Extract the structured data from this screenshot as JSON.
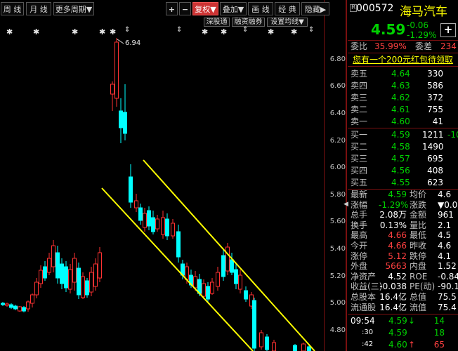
{
  "toolbar": {
    "left": [
      {
        "label": "周 线"
      },
      {
        "label": "月 线"
      },
      {
        "label": "更多周期▼"
      }
    ],
    "right": [
      {
        "label": "+"
      },
      {
        "label": "−"
      },
      {
        "label": "复权▼"
      },
      {
        "label": "叠加▼"
      },
      {
        "label": "画 线"
      },
      {
        "label": "经 典"
      },
      {
        "label": "隐藏▶"
      }
    ],
    "sub": [
      {
        "label": "深股通"
      },
      {
        "label": "融资融券"
      },
      {
        "label": "设置均线▼"
      }
    ]
  },
  "chart": {
    "max_label": "6.94",
    "y_labels": [
      "6.80",
      "6.60",
      "6.40",
      "6.20",
      "6.00",
      "5.80",
      "5.60",
      "5.40",
      "5.20",
      "5.00",
      "4.80"
    ]
  },
  "stock": {
    "code_prefix": "R",
    "code": "000572",
    "name": "海马汽车",
    "price": "4.59",
    "change": "-0.06",
    "change_pct": "-1.29%",
    "add_icon": "+",
    "weibi_label": "委比",
    "weibi_value": "35.99%",
    "weicha_label": "委差",
    "weicha_value": "234",
    "promo": "您有一个200元红包待领取",
    "sells": [
      {
        "label": "卖五",
        "price": "4.64",
        "vol": "330"
      },
      {
        "label": "卖四",
        "price": "4.63",
        "vol": "586"
      },
      {
        "label": "卖三",
        "price": "4.62",
        "vol": "372"
      },
      {
        "label": "卖二",
        "price": "4.61",
        "vol": "755"
      },
      {
        "label": "卖一",
        "price": "4.60",
        "vol": "41"
      }
    ],
    "buys": [
      {
        "label": "买一",
        "price": "4.59",
        "vol": "1211",
        "extra": "-10"
      },
      {
        "label": "买二",
        "price": "4.58",
        "vol": "1490",
        "extra": ""
      },
      {
        "label": "买三",
        "price": "4.57",
        "vol": "695",
        "extra": ""
      },
      {
        "label": "买四",
        "price": "4.56",
        "vol": "408",
        "extra": ""
      },
      {
        "label": "买五",
        "price": "4.55",
        "vol": "623",
        "extra": ""
      }
    ],
    "stats": [
      {
        "l1": "最新",
        "v1": "4.59",
        "c1": "green",
        "l2": "均价",
        "v2": "4.6"
      },
      {
        "l1": "涨幅",
        "v1": "-1.29%",
        "c1": "green",
        "l2": "涨跌",
        "v2": "▼0.0"
      },
      {
        "l1": "总手",
        "v1": "2.08万",
        "c1": "white",
        "l2": "金额",
        "v2": "961"
      },
      {
        "l1": "换手",
        "v1": "0.13%",
        "c1": "white",
        "l2": "量比",
        "v2": "2.1"
      },
      {
        "l1": "最高",
        "v1": "4.66",
        "c1": "red",
        "l2": "最低",
        "v2": "4.5"
      },
      {
        "l1": "今开",
        "v1": "4.66",
        "c1": "red",
        "l2": "昨收",
        "v2": "4.6"
      },
      {
        "l1": "涨停",
        "v1": "5.12",
        "c1": "red",
        "l2": "跌停",
        "v2": "4.1"
      },
      {
        "l1": "外盘",
        "v1": "5663",
        "c1": "red",
        "l2": "内盘",
        "v2": "1.52"
      },
      {
        "l1": "净资产",
        "v1": "4.52",
        "c1": "white",
        "l2": "ROE",
        "v2": "-0.84"
      },
      {
        "l1": "收益(三)",
        "v1": "-0.038",
        "c1": "white",
        "l2": "PE(动)",
        "v2": "-90.1"
      },
      {
        "l1": "总股本",
        "v1": "16.4亿",
        "c1": "white",
        "l2": "总值",
        "v2": "75.5"
      },
      {
        "l1": "流通股",
        "v1": "16.4亿",
        "c1": "white",
        "l2": "流值",
        "v2": "75.4"
      }
    ],
    "ticks": [
      {
        "time": "09:54",
        "price": "4.59",
        "arrow": "↓",
        "vol": "14",
        "vc": "green"
      },
      {
        "time": ":30",
        "price": "4.59",
        "arrow": "",
        "vol": "18",
        "vc": "green"
      },
      {
        "time": ":42",
        "price": "4.60",
        "arrow": "↑",
        "vol": "65",
        "vc": "red"
      }
    ]
  },
  "colors": {
    "up": "#ff3232",
    "down": "#00ffff",
    "channel": "#ffff00",
    "bg": "#000000"
  }
}
